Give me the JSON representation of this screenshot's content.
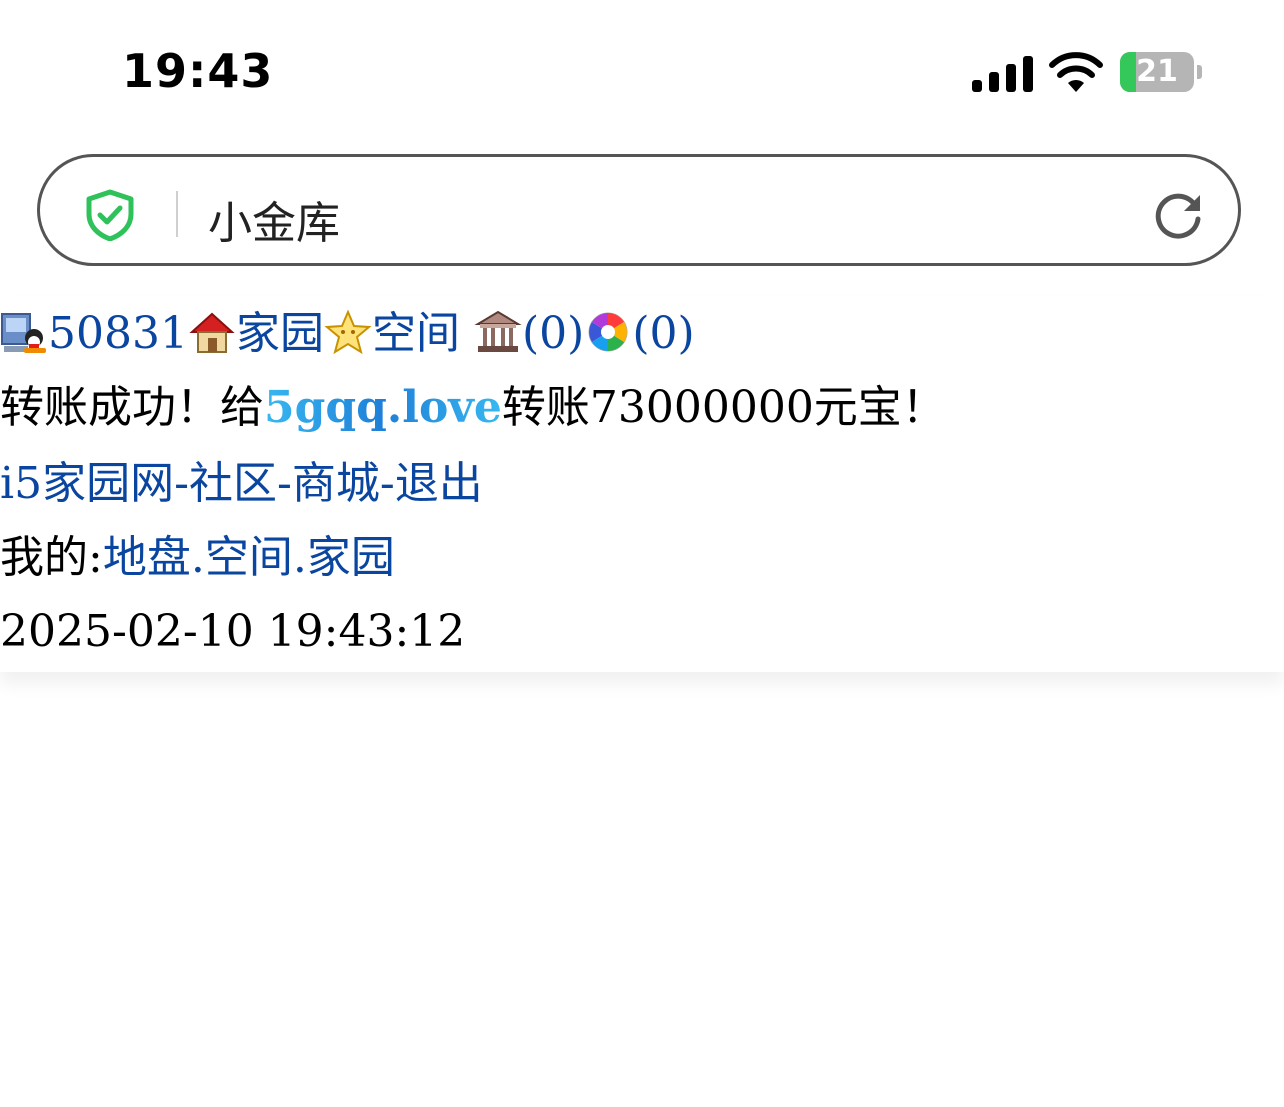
{
  "status_bar": {
    "time": "19:43",
    "battery_percent": "21",
    "battery_level": 0.21,
    "battery_fill_color": "#34c759"
  },
  "address_bar": {
    "page_title": "小金库",
    "icons": {
      "security": "shield-check-icon",
      "reload": "reload-icon"
    }
  },
  "nav_row": {
    "user_id": "50831",
    "home_label": "家园",
    "space_label": "空间",
    "bank_count": "(0)",
    "album_count": "(0)",
    "icons": [
      "user-computer-icon",
      "house-icon",
      "star-icon",
      "bank-icon",
      "pinwheel-icon"
    ]
  },
  "message": {
    "prefix": "转账成功！给",
    "recipient": "5gqq.love",
    "suffix": "转账73000000元宝！"
  },
  "site_links": {
    "items": [
      "i5家园网",
      "社区",
      "商城",
      "退出"
    ],
    "separator": "-"
  },
  "my_links": {
    "label": "我的:",
    "items": [
      "地盘",
      "空间",
      "家园"
    ],
    "separator": "."
  },
  "timestamp": "2025-02-10 19:43:12"
}
